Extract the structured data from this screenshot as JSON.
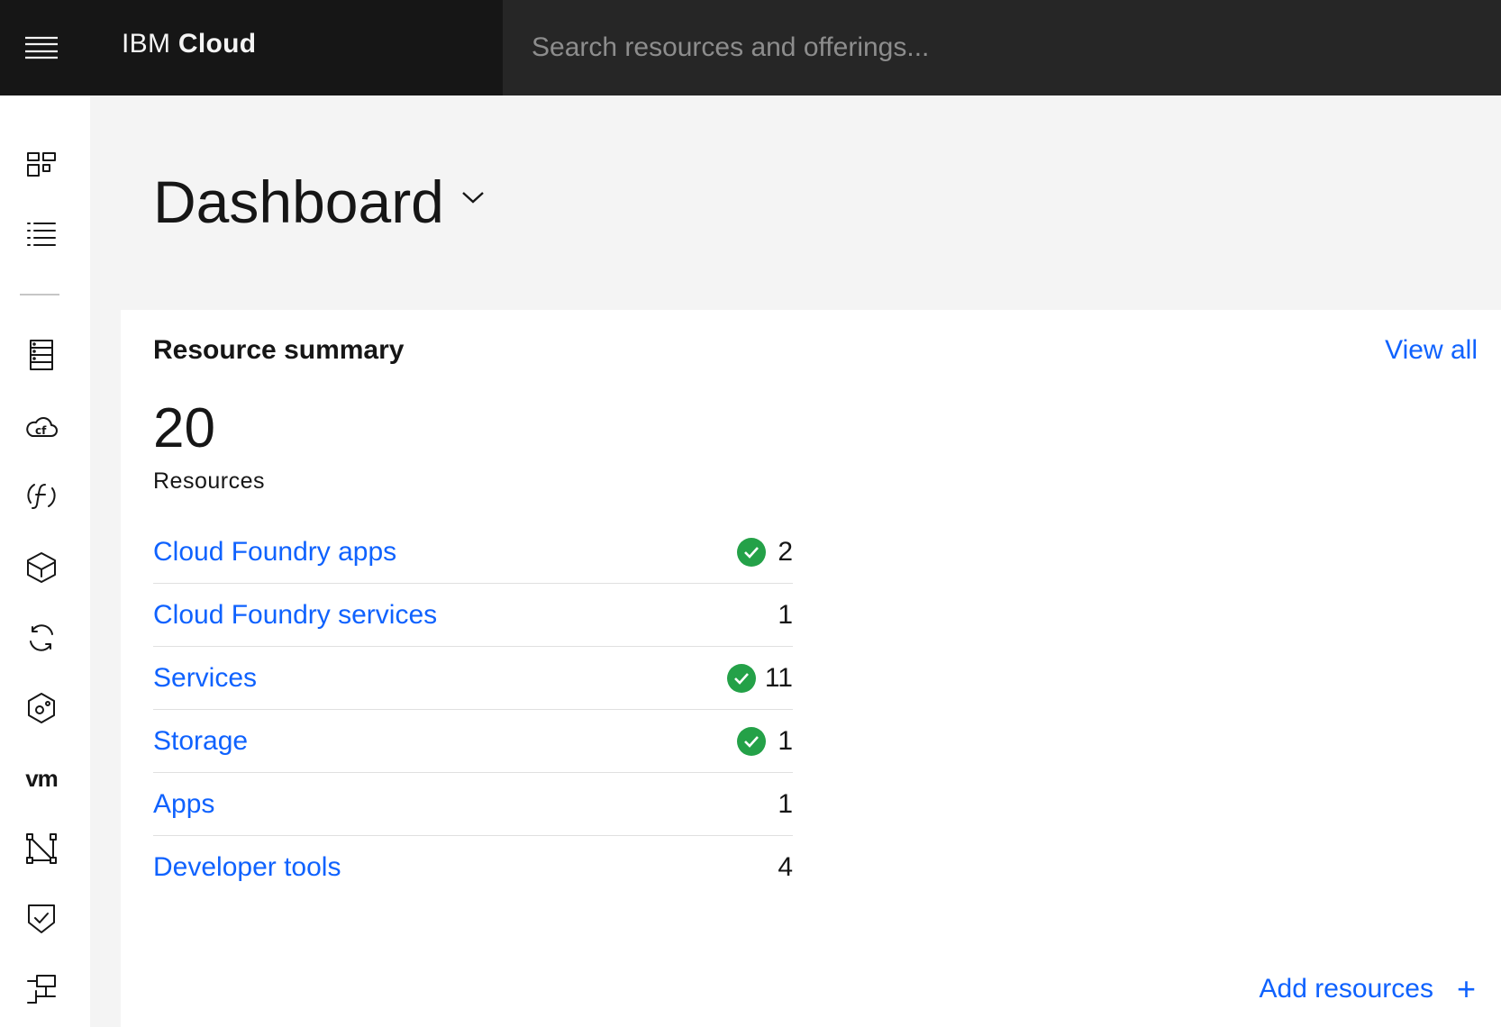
{
  "header": {
    "brand_prefix": "IBM",
    "brand_name": "Cloud",
    "search_placeholder": "Search resources and offerings..."
  },
  "sidebar": {
    "items": [
      {
        "icon": "dashboard-icon"
      },
      {
        "icon": "resource-list-icon"
      },
      {
        "icon": "classic-infrastructure-icon"
      },
      {
        "icon": "cloud-foundry-icon"
      },
      {
        "icon": "functions-icon"
      },
      {
        "icon": "kubernetes-icon"
      },
      {
        "icon": "openshift-icon"
      },
      {
        "icon": "vpc-icon"
      },
      {
        "icon": "vmware-icon",
        "text": "vm"
      },
      {
        "icon": "interconnectivity-icon"
      },
      {
        "icon": "security-icon"
      },
      {
        "icon": "satellite-icon"
      }
    ]
  },
  "page": {
    "title": "Dashboard"
  },
  "resource_summary": {
    "title": "Resource summary",
    "view_all": "View all",
    "total": "20",
    "total_label": "Resources",
    "rows": [
      {
        "label": "Cloud Foundry apps",
        "count": "2",
        "status": "ok"
      },
      {
        "label": "Cloud Foundry services",
        "count": "1",
        "status": ""
      },
      {
        "label": "Services",
        "count": "11",
        "status": "ok"
      },
      {
        "label": "Storage",
        "count": "1",
        "status": "ok"
      },
      {
        "label": "Apps",
        "count": "1",
        "status": ""
      },
      {
        "label": "Developer tools",
        "count": "4",
        "status": ""
      }
    ],
    "add_resources": "Add resources",
    "add_symbol": "+"
  },
  "colors": {
    "link": "#0f62fe",
    "success": "#24a148",
    "header_bg": "#262626",
    "header_brand_bg": "#161616"
  }
}
